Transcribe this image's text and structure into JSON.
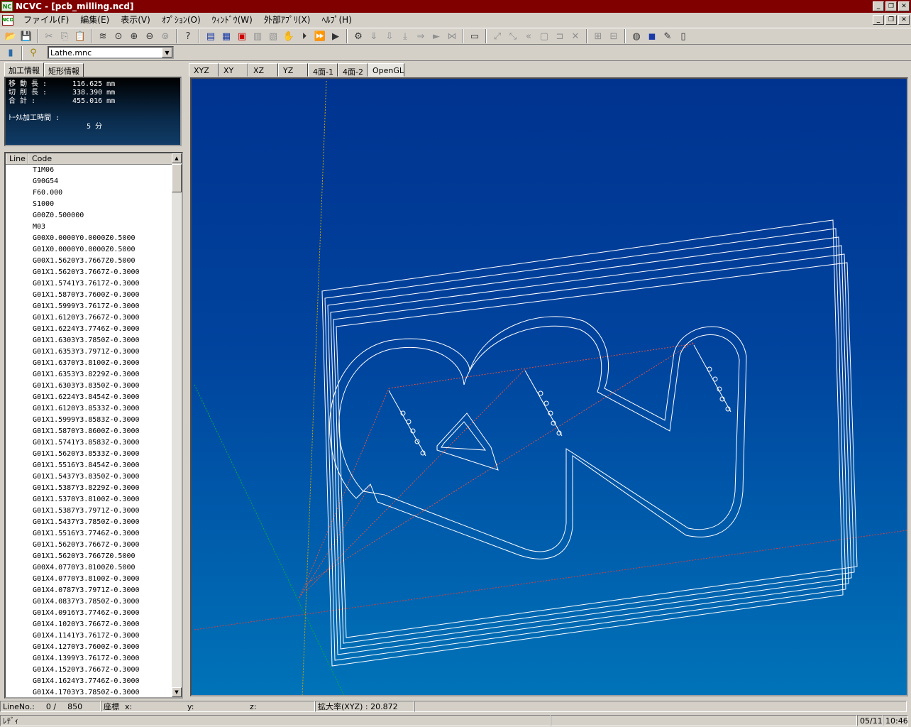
{
  "window": {
    "title": "NCVC - [pcb_milling.ncd]",
    "app_icon": "NC"
  },
  "menu": [
    "ファイル(F)",
    "編集(E)",
    "表示(V)",
    "ｵﾌﾟｼｮﾝ(O)",
    "ｳｨﾝﾄﾞｳ(W)",
    "外部ｱﾌﾟﾘ(X)",
    "ﾍﾙﾌﾟ(H)"
  ],
  "combo": {
    "value": "Lathe.mnc"
  },
  "left_tabs": [
    "加工情報",
    "矩形情報"
  ],
  "info": {
    "move_label": "移 動 長 :",
    "move_value": "116.625 mm",
    "cut_label": "切 削 長 :",
    "cut_value": "338.390 mm",
    "total_label": "合   計 :",
    "total_value": "455.016 mm",
    "time_label": "ﾄｰﾀﾙ加工時間 :",
    "time_value": "5 分"
  },
  "code_list": {
    "headers": [
      "Line",
      "Code"
    ],
    "rows": [
      "T1M06",
      "G90G54",
      "F60.000",
      "S1000",
      "G00Z0.500000",
      "M03",
      "G00X0.0000Y0.0000Z0.5000",
      "G01X0.0000Y0.0000Z0.5000",
      "G00X1.5620Y3.7667Z0.5000",
      "G01X1.5620Y3.7667Z-0.3000",
      "G01X1.5741Y3.7617Z-0.3000",
      "G01X1.5870Y3.7600Z-0.3000",
      "G01X1.5999Y3.7617Z-0.3000",
      "G01X1.6120Y3.7667Z-0.3000",
      "G01X1.6224Y3.7746Z-0.3000",
      "G01X1.6303Y3.7850Z-0.3000",
      "G01X1.6353Y3.7971Z-0.3000",
      "G01X1.6370Y3.8100Z-0.3000",
      "G01X1.6353Y3.8229Z-0.3000",
      "G01X1.6303Y3.8350Z-0.3000",
      "G01X1.6224Y3.8454Z-0.3000",
      "G01X1.6120Y3.8533Z-0.3000",
      "G01X1.5999Y3.8583Z-0.3000",
      "G01X1.5870Y3.8600Z-0.3000",
      "G01X1.5741Y3.8583Z-0.3000",
      "G01X1.5620Y3.8533Z-0.3000",
      "G01X1.5516Y3.8454Z-0.3000",
      "G01X1.5437Y3.8350Z-0.3000",
      "G01X1.5387Y3.8229Z-0.3000",
      "G01X1.5370Y3.8100Z-0.3000",
      "G01X1.5387Y3.7971Z-0.3000",
      "G01X1.5437Y3.7850Z-0.3000",
      "G01X1.5516Y3.7746Z-0.3000",
      "G01X1.5620Y3.7667Z-0.3000",
      "G01X1.5620Y3.7667Z0.5000",
      "G00X4.0770Y3.8100Z0.5000",
      "G01X4.0770Y3.8100Z-0.3000",
      "G01X4.0787Y3.7971Z-0.3000",
      "G01X4.0837Y3.7850Z-0.3000",
      "G01X4.0916Y3.7746Z-0.3000",
      "G01X4.1020Y3.7667Z-0.3000",
      "G01X4.1141Y3.7617Z-0.3000",
      "G01X4.1270Y3.7600Z-0.3000",
      "G01X4.1399Y3.7617Z-0.3000",
      "G01X4.1520Y3.7667Z-0.3000",
      "G01X4.1624Y3.7746Z-0.3000",
      "G01X4.1703Y3.7850Z-0.3000"
    ]
  },
  "view_tabs": [
    "XYZ",
    "XY",
    "XZ",
    "YZ",
    "4面-1",
    "4面-2",
    "OpenGL"
  ],
  "status": {
    "line_label": "LineNo.:",
    "line_cur": "0 /",
    "line_total": "850",
    "coord_label": "座標",
    "x_label": "x:",
    "y_label": "y:",
    "z_label": "z:",
    "zoom": "拡大率(XYZ) : 20.872",
    "ready": "ﾚﾃﾞｨ",
    "date": "05/11",
    "time": "10:46"
  }
}
